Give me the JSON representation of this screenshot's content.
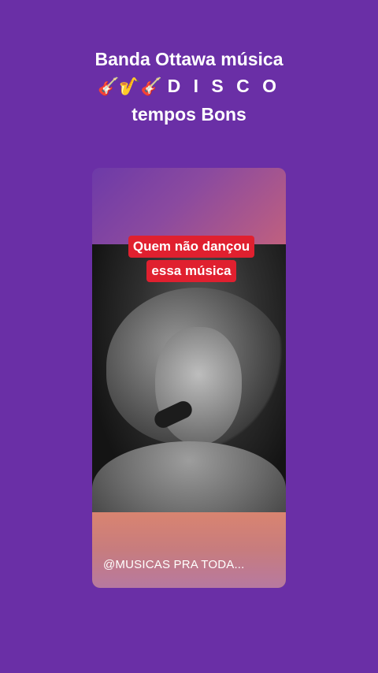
{
  "post": {
    "title_line1": "Banda Ottawa  música",
    "title_emojis": "🎸🎷🎸",
    "title_disco": "D I S C O",
    "title_line3": "tempos Bons"
  },
  "video": {
    "caption_line1": "Quem não dançou",
    "caption_line2": "essa música",
    "username": "@MUSICAS PRA TODA..."
  },
  "colors": {
    "background": "#6a2fa6",
    "caption_bg": "#e0202f"
  }
}
